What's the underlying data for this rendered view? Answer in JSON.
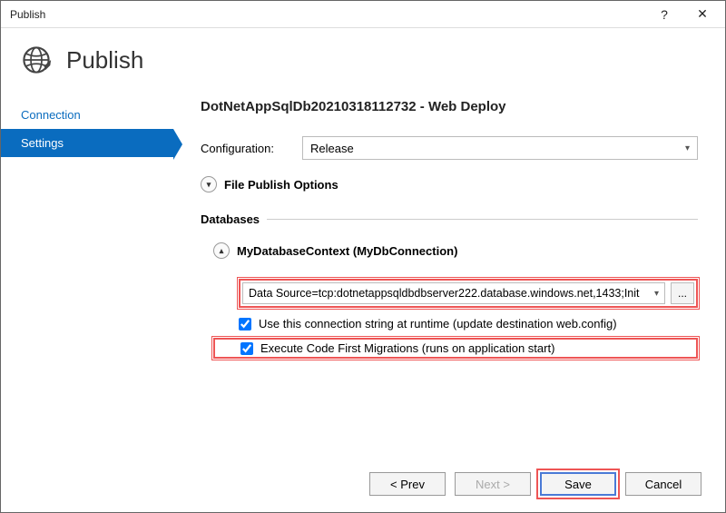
{
  "title": "Publish",
  "header": "Publish",
  "sidebar": {
    "items": [
      {
        "label": "Connection"
      },
      {
        "label": "Settings"
      }
    ]
  },
  "profileTitle": "DotNetAppSqlDb20210318112732 - Web Deploy",
  "configLabel": "Configuration:",
  "configValue": "Release",
  "filePublishOptions": "File Publish Options",
  "databasesTitle": "Databases",
  "dbContext": "MyDatabaseContext (MyDbConnection)",
  "connString": "Data Source=tcp:dotnetappsqldbdbserver222.database.windows.net,1433;Init",
  "browseLabel": "...",
  "cb1": "Use this connection string at runtime (update destination web.config)",
  "cb2": "Execute Code First Migrations (runs on application start)",
  "buttons": {
    "prev": "< Prev",
    "next": "Next >",
    "save": "Save",
    "cancel": "Cancel"
  }
}
